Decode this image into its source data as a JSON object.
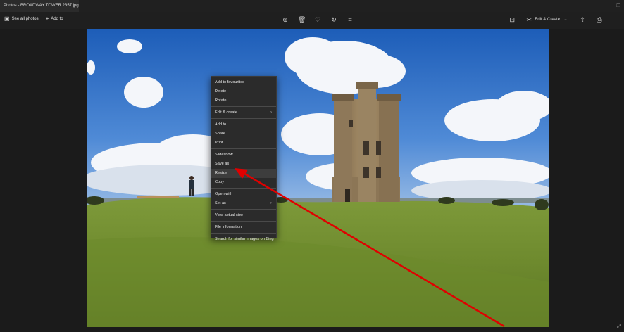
{
  "window": {
    "title": "Photos - BROADWAY TOWER 2357.jpg"
  },
  "toolbar": {
    "see_all": "See all photos",
    "add_to": "Add to",
    "edit_create": "Edit & Create",
    "icons_center": [
      "zoom-icon",
      "delete-icon",
      "favourite-icon",
      "rotate-icon",
      "crop-icon"
    ],
    "icons_right": [
      "info-icon",
      "edit-create-icon",
      "share-icon",
      "print-icon",
      "more-icon"
    ]
  },
  "context_menu": {
    "highlighted": "Resize",
    "groups": [
      [
        {
          "label": "Add to favourites"
        },
        {
          "label": "Delete"
        },
        {
          "label": "Rotate"
        }
      ],
      [
        {
          "label": "Edit & create",
          "submenu": true
        }
      ],
      [
        {
          "label": "Add to"
        },
        {
          "label": "Share"
        },
        {
          "label": "Print"
        }
      ],
      [
        {
          "label": "Slideshow"
        },
        {
          "label": "Save as"
        },
        {
          "label": "Resize"
        },
        {
          "label": "Copy"
        }
      ],
      [
        {
          "label": "Open with"
        },
        {
          "label": "Set as",
          "submenu": true
        }
      ],
      [
        {
          "label": "View actual size"
        }
      ],
      [
        {
          "label": "File information"
        }
      ],
      [
        {
          "label": "Search for similar images on Bing"
        }
      ]
    ]
  },
  "colors": {
    "annotation_arrow": "#e00000",
    "menu_bg": "#2b2b2b"
  }
}
